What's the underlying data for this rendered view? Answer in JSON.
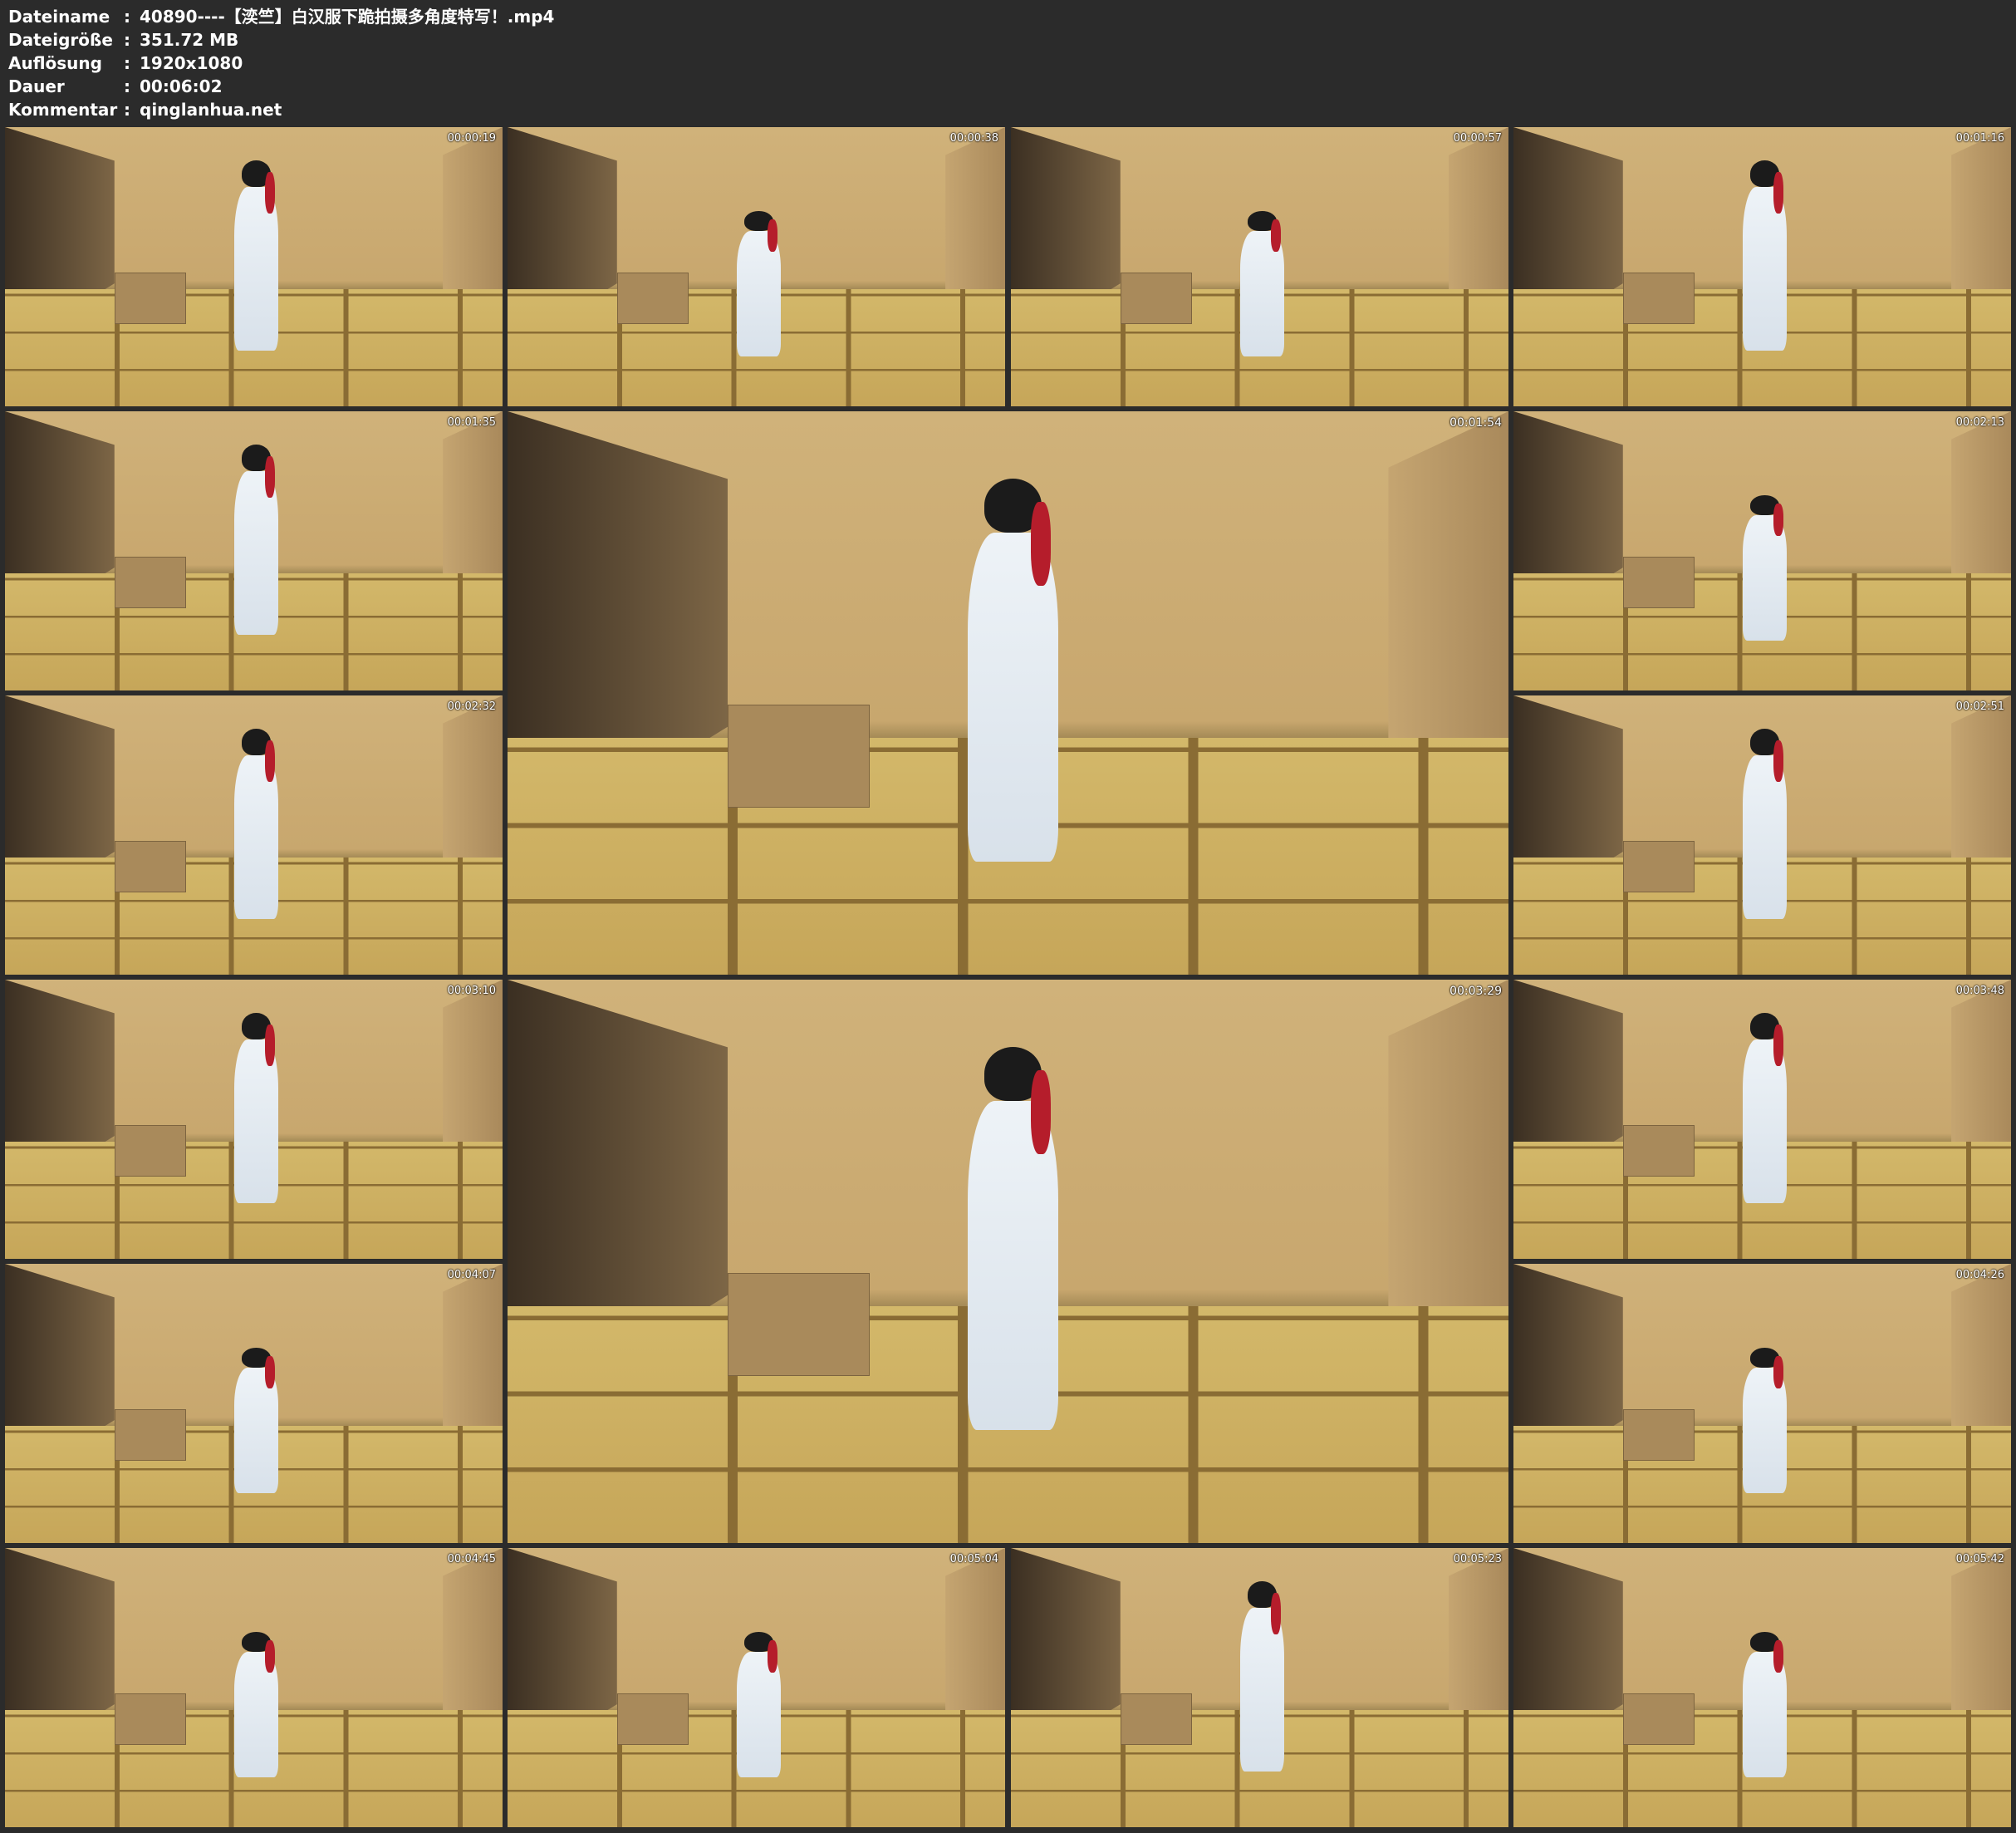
{
  "header": {
    "rows": [
      {
        "label": "Dateiname",
        "value": "40890----【湙竺】白汉服下跪拍摄多角度特写！.mp4"
      },
      {
        "label": "Dateigröße",
        "value": "351.72 MB"
      },
      {
        "label": "Auflösung",
        "value": "1920x1080"
      },
      {
        "label": "Dauer",
        "value": "00:06:02"
      },
      {
        "label": "Kommentar",
        "value": "qinglanhua.net"
      }
    ],
    "separator": ":"
  },
  "thumbnails": [
    {
      "timestamp": "00:00:19",
      "pose": "standing"
    },
    {
      "timestamp": "00:00:38",
      "pose": "kneeling"
    },
    {
      "timestamp": "00:00:57",
      "pose": "kneeling"
    },
    {
      "timestamp": "00:01:16",
      "pose": "standing"
    },
    {
      "timestamp": "00:01:35",
      "pose": "standing"
    },
    {
      "timestamp": "00:01:54",
      "pose": "standing"
    },
    {
      "timestamp": "00:02:13",
      "pose": "kneeling"
    },
    {
      "timestamp": "00:02:32",
      "pose": "standing"
    },
    {
      "timestamp": "00:02:51",
      "pose": "standing"
    },
    {
      "timestamp": "00:03:10",
      "pose": "standing"
    },
    {
      "timestamp": "00:03:29",
      "pose": "standing"
    },
    {
      "timestamp": "00:03:48",
      "pose": "standing"
    },
    {
      "timestamp": "00:04:07",
      "pose": "kneeling"
    },
    {
      "timestamp": "00:04:26",
      "pose": "kneeling"
    },
    {
      "timestamp": "00:04:45",
      "pose": "kneeling"
    },
    {
      "timestamp": "00:05:04",
      "pose": "kneeling"
    },
    {
      "timestamp": "00:05:23",
      "pose": "standing"
    },
    {
      "timestamp": "00:05:42",
      "pose": "kneeling"
    }
  ]
}
